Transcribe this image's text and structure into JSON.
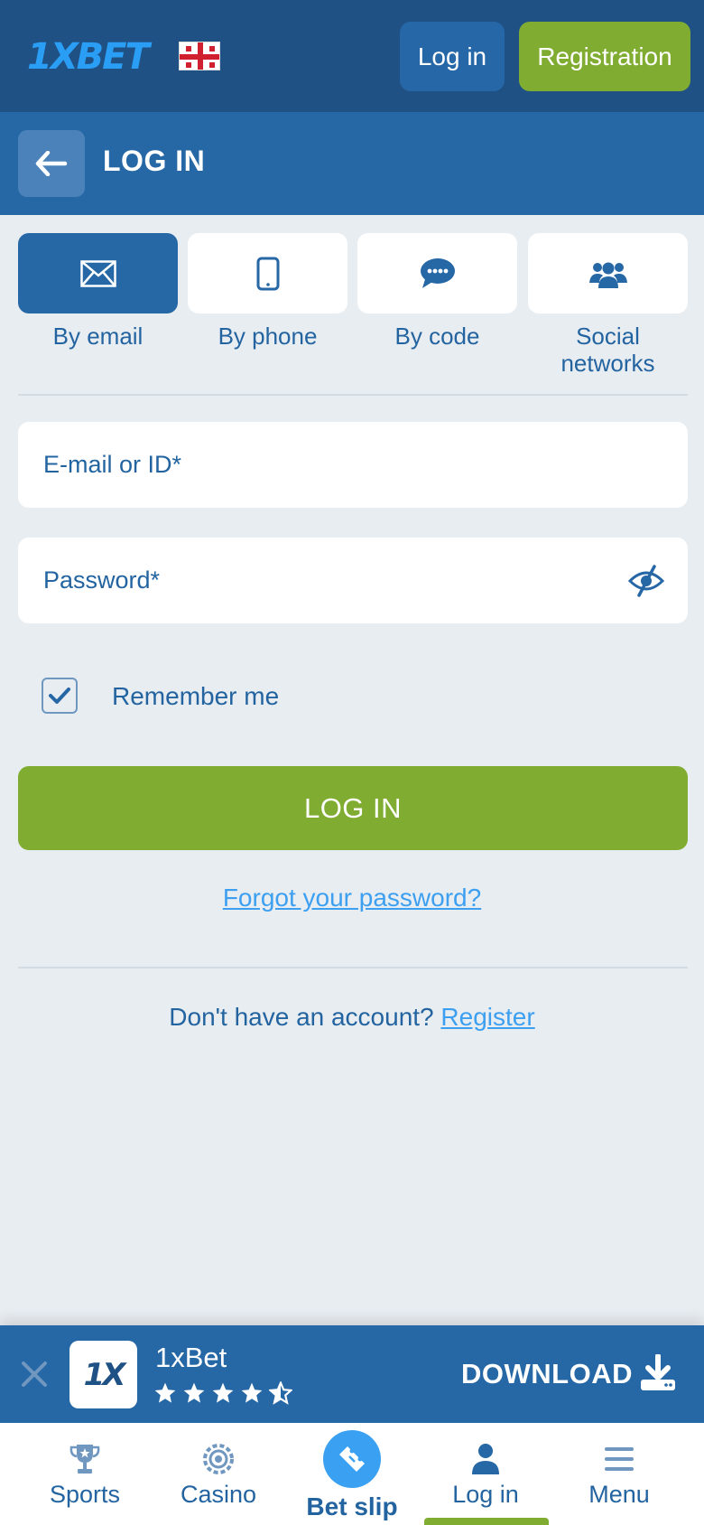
{
  "header": {
    "logo_text": "1XBET",
    "login_label": "Log in",
    "registration_label": "Registration"
  },
  "titlebar": {
    "title": "LOG IN"
  },
  "login_methods": [
    {
      "label": "By email",
      "icon": "envelope-icon",
      "active": true
    },
    {
      "label": "By phone",
      "icon": "phone-icon",
      "active": false
    },
    {
      "label": "By code",
      "icon": "chat-icon",
      "active": false
    },
    {
      "label": "Social networks",
      "icon": "users-icon",
      "active": false
    }
  ],
  "form": {
    "email_placeholder": "E-mail or ID*",
    "password_placeholder": "Password*",
    "remember_label": "Remember me",
    "remember_checked": true,
    "submit_label": "LOG IN",
    "forgot_label": "Forgot your password?",
    "no_account_text": "Don't have an account?",
    "register_link": "Register"
  },
  "banner": {
    "app_icon_text": "1X",
    "app_name": "1xBet",
    "rating": 4.5,
    "download_label": "DOWNLOAD"
  },
  "bottom_nav": [
    {
      "label": "Sports",
      "icon": "trophy-icon"
    },
    {
      "label": "Casino",
      "icon": "casino-chip-icon"
    },
    {
      "label": "Bet slip",
      "icon": "ticket-icon"
    },
    {
      "label": "Log in",
      "icon": "user-icon"
    },
    {
      "label": "Menu",
      "icon": "hamburger-icon"
    }
  ],
  "colors": {
    "header_bg": "#1f5185",
    "primary_blue": "#2667a6",
    "accent_green": "#80ad31",
    "link_blue": "#3d9ff0",
    "page_bg": "#e8edf2"
  }
}
